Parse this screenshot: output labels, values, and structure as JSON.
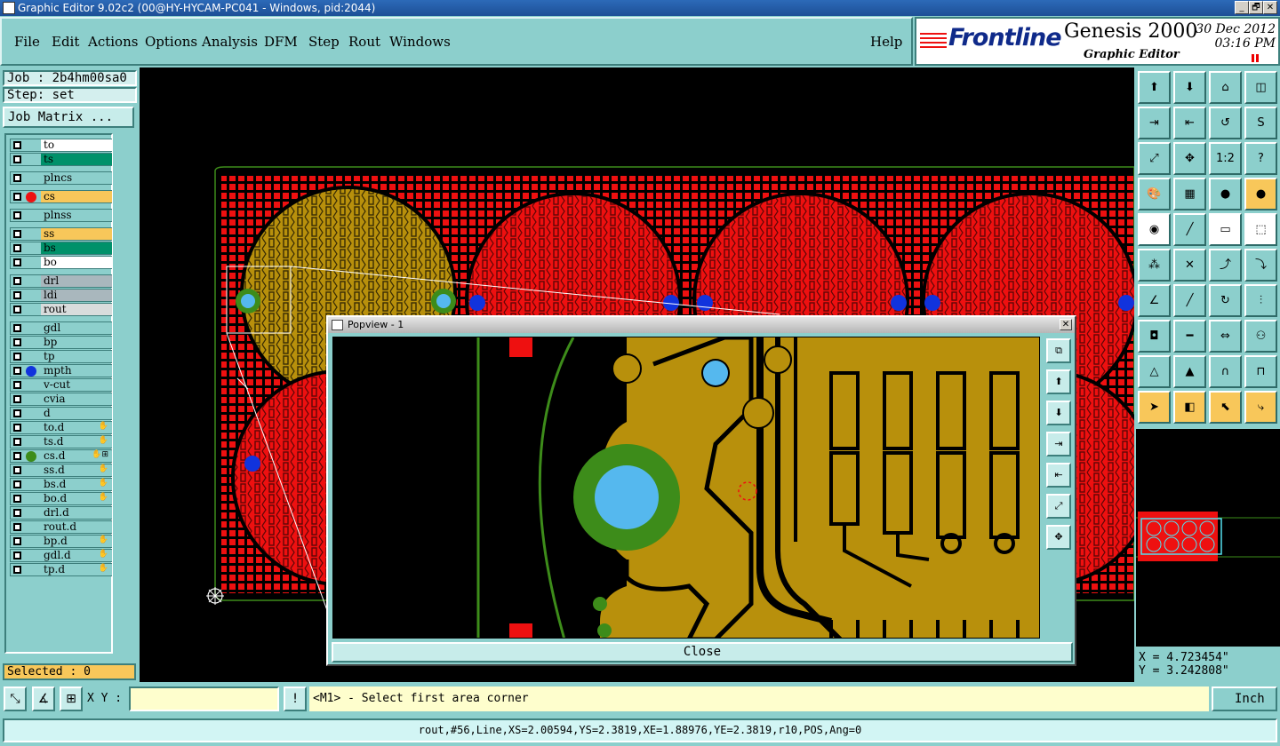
{
  "window": {
    "title": "Graphic Editor 9.02c2 (00@HY-HYCAM-PC041 - Windows, pid:2044)",
    "min_label": "_",
    "max_label": "🗗",
    "close_label": "✕"
  },
  "menu": {
    "file": "File",
    "edit": "Edit",
    "actions": "Actions",
    "options": "Options",
    "analysis": "Analysis",
    "dfm": "DFM",
    "step": "Step",
    "rout": "Rout",
    "windows": "Windows",
    "help": "Help"
  },
  "brand": {
    "logo": "Frontline",
    "product": "Genesis 2000",
    "subtitle": "Graphic Editor",
    "date": "30 Dec 2012",
    "time": "03:16 PM"
  },
  "job": {
    "job_line": "Job : 2b4hm00sa0",
    "step_line": "Step: set",
    "matrix_button": "Job Matrix ..."
  },
  "layers": [
    {
      "name": "to",
      "bg": "#ffffff",
      "dot": ""
    },
    {
      "name": "ts",
      "bg": "#00916a",
      "dot": ""
    },
    {
      "name": "plncs",
      "bg": "#8ccfcc",
      "dot": ""
    },
    {
      "name": "cs",
      "bg": "#f8c75a",
      "dot": "#ee1111"
    },
    {
      "name": "plnss",
      "bg": "#8ccfcc",
      "dot": ""
    },
    {
      "name": "ss",
      "bg": "#f8c75a",
      "dot": ""
    },
    {
      "name": "bs",
      "bg": "#00916a",
      "dot": ""
    },
    {
      "name": "bo",
      "bg": "#ffffff",
      "dot": ""
    },
    {
      "name": "drl",
      "bg": "#a9b7bd",
      "dot": ""
    },
    {
      "name": "ldi",
      "bg": "#a9b7bd",
      "dot": ""
    },
    {
      "name": "rout",
      "bg": "#d8dcdc",
      "dot": ""
    },
    {
      "name": "gdl",
      "bg": "#8ccfcc",
      "dot": ""
    },
    {
      "name": "bp",
      "bg": "#8ccfcc",
      "dot": ""
    },
    {
      "name": "tp",
      "bg": "#8ccfcc",
      "dot": ""
    },
    {
      "name": "mpth",
      "bg": "#8ccfcc",
      "dot": "#1133dd"
    },
    {
      "name": "v-cut",
      "bg": "#8ccfcc",
      "dot": ""
    },
    {
      "name": "cvia",
      "bg": "#8ccfcc",
      "dot": ""
    },
    {
      "name": "d",
      "bg": "#8ccfcc",
      "dot": ""
    },
    {
      "name": "to.d",
      "bg": "#8ccfcc",
      "dot": "",
      "flag": "✋"
    },
    {
      "name": "ts.d",
      "bg": "#8ccfcc",
      "dot": "",
      "flag": "✋"
    },
    {
      "name": "cs.d",
      "bg": "#8ccfcc",
      "dot": "#3d8c1a",
      "flag": "✋⊞"
    },
    {
      "name": "ss.d",
      "bg": "#8ccfcc",
      "dot": "",
      "flag": "✋"
    },
    {
      "name": "bs.d",
      "bg": "#8ccfcc",
      "dot": "",
      "flag": "✋"
    },
    {
      "name": "bo.d",
      "bg": "#8ccfcc",
      "dot": "",
      "flag": "✋"
    },
    {
      "name": "drl.d",
      "bg": "#8ccfcc",
      "dot": ""
    },
    {
      "name": "rout.d",
      "bg": "#8ccfcc",
      "dot": ""
    },
    {
      "name": "bp.d",
      "bg": "#8ccfcc",
      "dot": "",
      "flag": "✋"
    },
    {
      "name": "gdl.d",
      "bg": "#8ccfcc",
      "dot": "",
      "flag": "✋"
    },
    {
      "name": "tp.d",
      "bg": "#8ccfcc",
      "dot": "",
      "flag": "✋"
    }
  ],
  "selected": "Selected : 0",
  "tools": [
    {
      "name": "open-step-icon",
      "glyph": "⬆",
      "style": ""
    },
    {
      "name": "save-icon",
      "glyph": "⬇",
      "style": ""
    },
    {
      "name": "home-icon",
      "glyph": "⌂",
      "style": ""
    },
    {
      "name": "window-split-icon",
      "glyph": "◫",
      "style": ""
    },
    {
      "name": "import-icon",
      "glyph": "⇥",
      "style": ""
    },
    {
      "name": "export-icon",
      "glyph": "⇤",
      "style": ""
    },
    {
      "name": "flip-icon",
      "glyph": "↺",
      "style": ""
    },
    {
      "name": "snake-icon",
      "glyph": "S",
      "style": ""
    },
    {
      "name": "zoom-fit-icon",
      "glyph": "⤢",
      "style": ""
    },
    {
      "name": "zoom-center-icon",
      "glyph": "✥",
      "style": ""
    },
    {
      "name": "ratio-icon",
      "glyph": "1:2",
      "style": ""
    },
    {
      "name": "help-query-icon",
      "glyph": "?",
      "style": ""
    },
    {
      "name": "palette-icon",
      "glyph": "🎨",
      "style": ""
    },
    {
      "name": "grid-icon",
      "glyph": "▦",
      "style": ""
    },
    {
      "name": "layers-color-icon",
      "glyph": "●",
      "style": ""
    },
    {
      "name": "layers-active-icon",
      "glyph": "●",
      "style": "orange"
    },
    {
      "name": "pad-add-icon",
      "glyph": "◉",
      "style": "white"
    },
    {
      "name": "line-add-icon",
      "glyph": "╱",
      "style": ""
    },
    {
      "name": "ruler-icon",
      "glyph": "▭",
      "style": "white"
    },
    {
      "name": "dotted-rect-icon",
      "glyph": "⬚",
      "style": "white"
    },
    {
      "name": "connect-icon",
      "glyph": "⁂",
      "style": ""
    },
    {
      "name": "cross-icon",
      "glyph": "✕",
      "style": ""
    },
    {
      "name": "move-point-icon",
      "glyph": "⤴",
      "style": ""
    },
    {
      "name": "move-arrow-icon",
      "glyph": "⤵",
      "style": ""
    },
    {
      "name": "angle-icon",
      "glyph": "∠",
      "style": ""
    },
    {
      "name": "slash-icon",
      "glyph": "╱",
      "style": ""
    },
    {
      "name": "arc-icon",
      "glyph": "↻",
      "style": ""
    },
    {
      "name": "split-icon",
      "glyph": "⫶",
      "style": ""
    },
    {
      "name": "shape-add-icon",
      "glyph": "◘",
      "style": ""
    },
    {
      "name": "minus-icon",
      "glyph": "━",
      "style": ""
    },
    {
      "name": "measure-icon",
      "glyph": "⇔",
      "style": ""
    },
    {
      "name": "circles-icon",
      "glyph": "⚇",
      "style": ""
    },
    {
      "name": "triangle-icon",
      "glyph": "△",
      "style": ""
    },
    {
      "name": "triangle-a-icon",
      "glyph": "▲",
      "style": ""
    },
    {
      "name": "arch-icon",
      "glyph": "∩",
      "style": ""
    },
    {
      "name": "arch-split-icon",
      "glyph": "⊓",
      "style": ""
    },
    {
      "name": "pointer-icon",
      "glyph": "➤",
      "style": "orange"
    },
    {
      "name": "select-box-icon",
      "glyph": "◧",
      "style": "orange"
    },
    {
      "name": "select-arrow-icon",
      "glyph": "⬉",
      "style": "orange"
    },
    {
      "name": "net-select-icon",
      "glyph": "⤷",
      "style": "orange"
    }
  ],
  "coords": {
    "x": "X = 4.723454\"",
    "y": "Y = 3.242808\""
  },
  "command": {
    "xy_label": "X Y :",
    "xy_value": "",
    "warn_glyph": "!",
    "prompt": "<M1> - Select first area corner",
    "units": "Inch"
  },
  "status": "rout,#56,Line,XS=2.00594,YS=2.3819,XE=1.88976,YE=2.3819,r10,POS,Ang=0",
  "popview": {
    "title": "Popview - 1",
    "close_x": "✕",
    "close_button": "Close",
    "tools": [
      "⧉",
      "⬆",
      "⬇",
      "⇥",
      "⇤",
      "⤢",
      "✥"
    ]
  },
  "colors": {
    "panel": "#8ccfcc",
    "copper": "#b8900c",
    "soldermask_red": "#ee1010",
    "outline_green": "#3d8c1a",
    "hole_blue": "#1133dd"
  }
}
